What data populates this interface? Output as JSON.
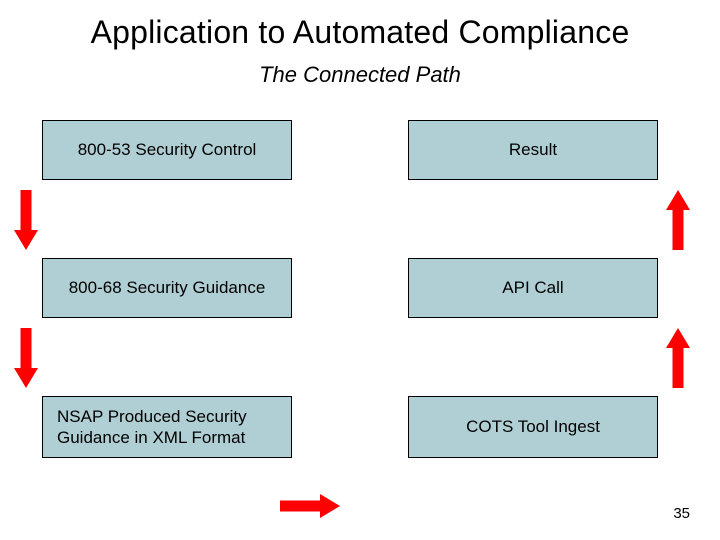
{
  "title": "Application to Automated Compliance",
  "subtitle": "The Connected Path",
  "boxes": {
    "left_top": "800-53 Security Control",
    "left_mid": "800-68 Security Guidance",
    "left_bot": "NSAP Produced Security Guidance in XML Format",
    "right_top": "Result",
    "right_mid": "API Call",
    "right_bot": "COTS Tool Ingest"
  },
  "page_number": "35",
  "arrow_color": "#ff0000"
}
